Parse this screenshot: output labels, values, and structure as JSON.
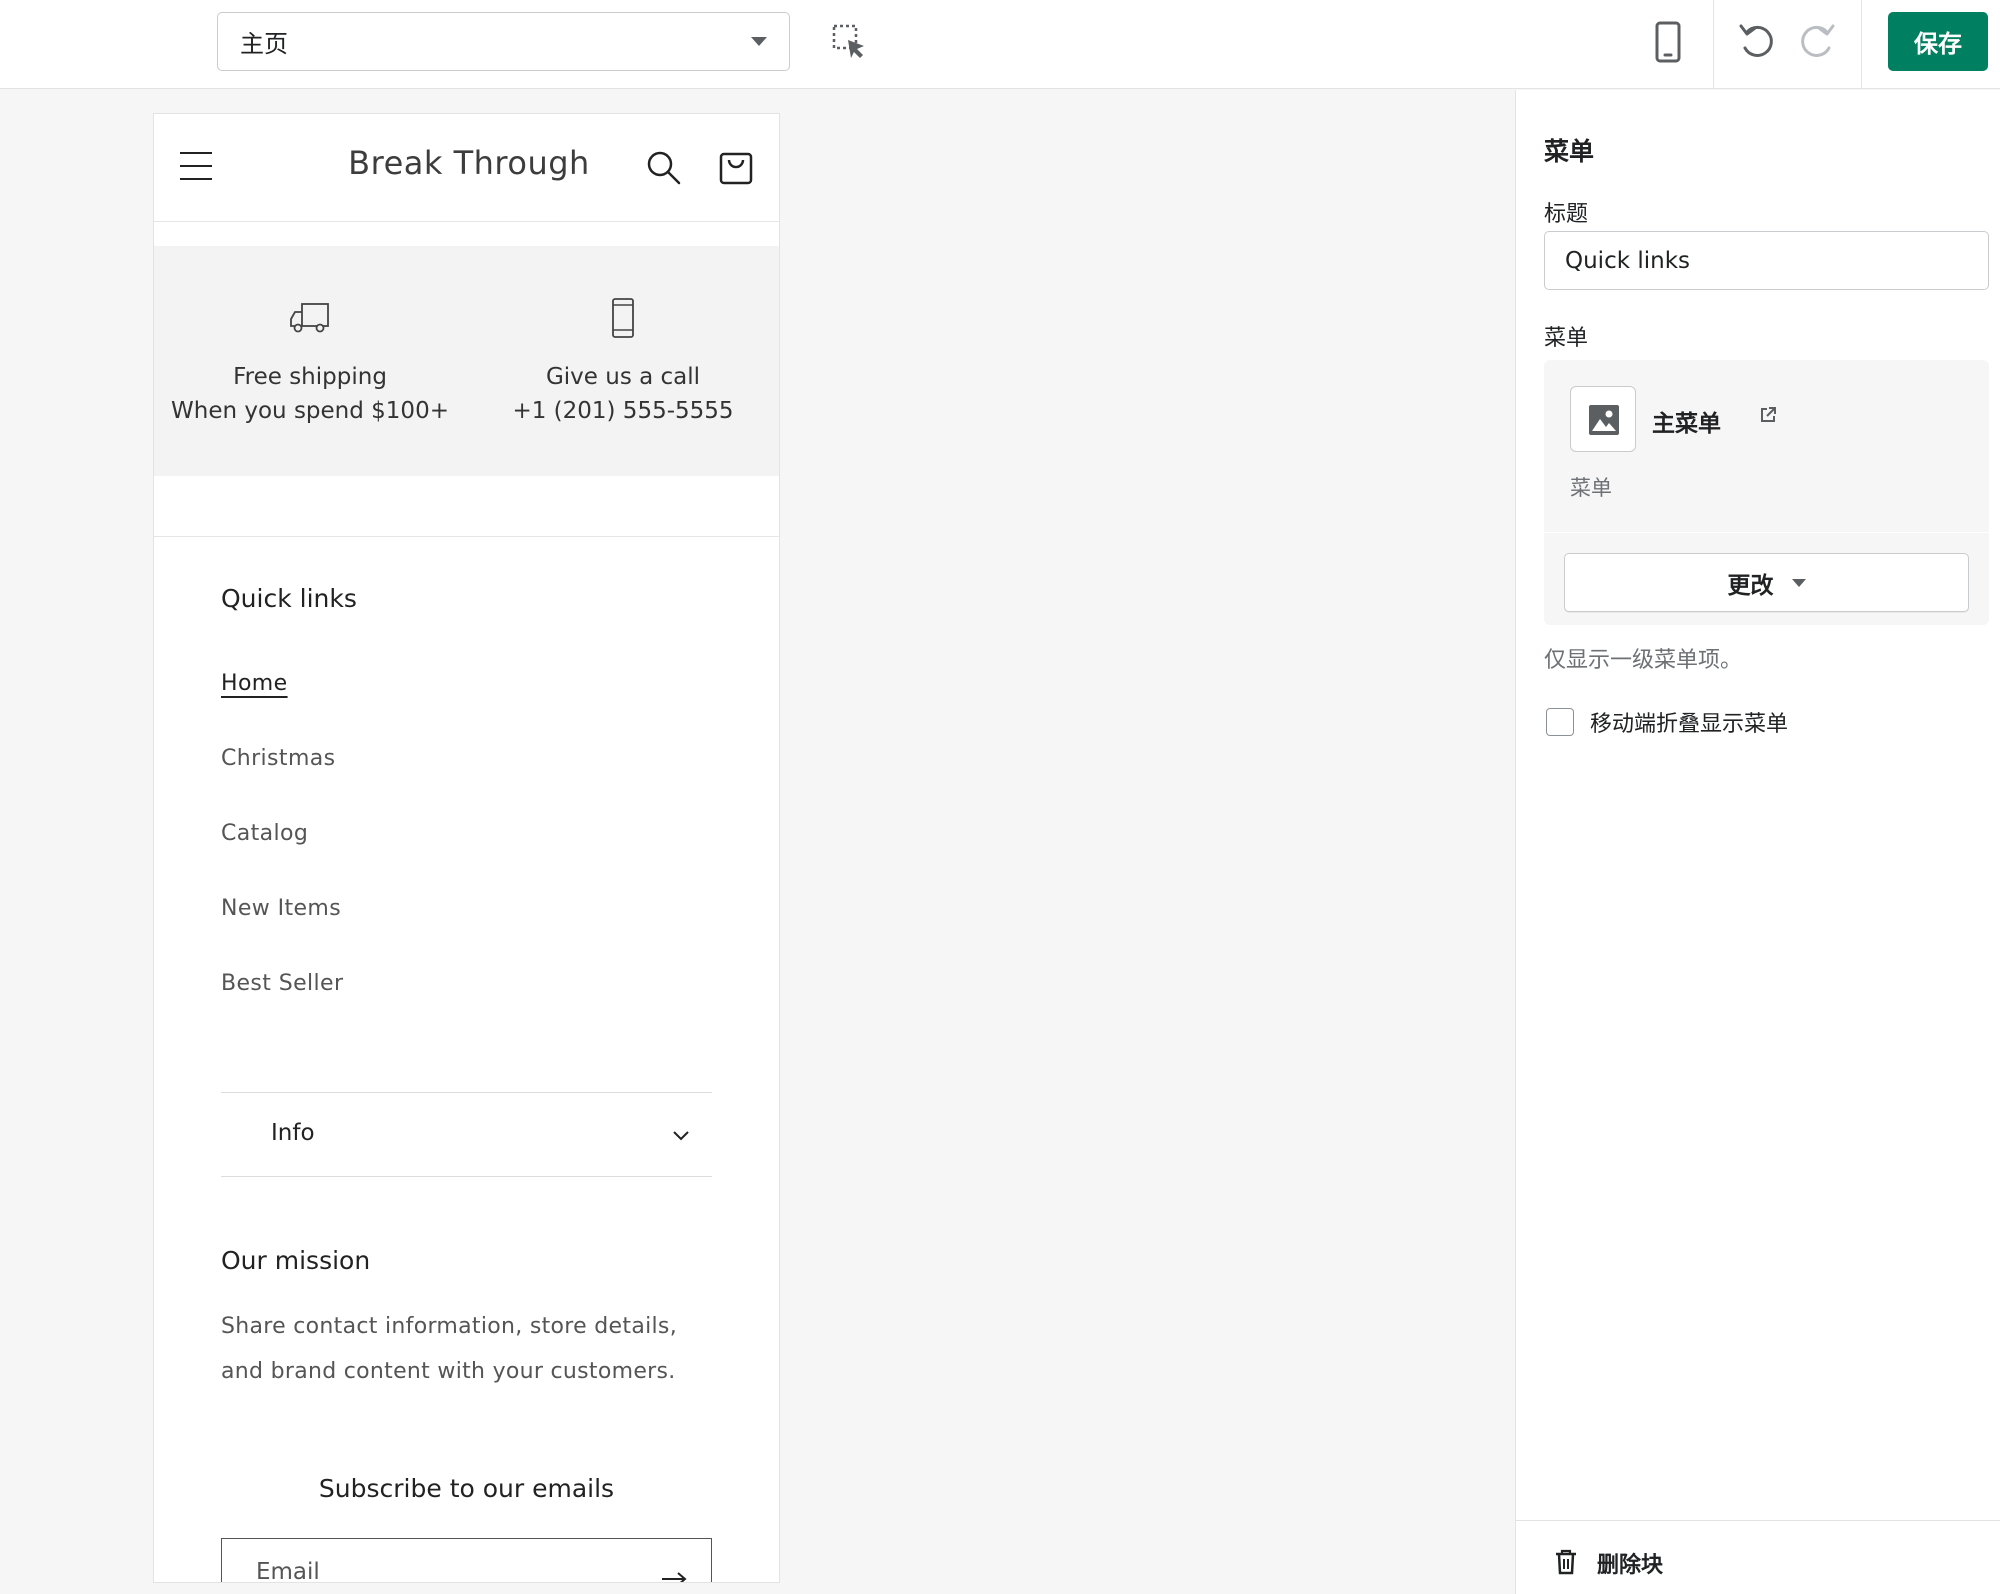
{
  "toolbar": {
    "page_select": "主页",
    "save_label": "保存"
  },
  "store": {
    "title": "Break Through",
    "promos": [
      {
        "line1": "Free shipping",
        "line2": "When you spend $100+"
      },
      {
        "line1": "Give us a call",
        "line2": "+1 (201) 555-5555"
      }
    ],
    "quick_links": {
      "title": "Quick links",
      "items": [
        "Home",
        "Christmas",
        "Catalog",
        "New Items",
        "Best Seller"
      ]
    },
    "info_label": "Info",
    "mission": {
      "title": "Our mission",
      "text": "Share contact information, store details, and brand content with your customers."
    },
    "subscribe": {
      "title": "Subscribe to our emails",
      "email_label": "Email"
    }
  },
  "panel": {
    "title": "菜单",
    "title_field_label": "标题",
    "title_field_value": "Quick links",
    "menu_label": "菜单",
    "menu_card": {
      "name": "主菜单",
      "subtitle": "菜单"
    },
    "change_label": "更改",
    "help_text": "仅显示一级菜单项。",
    "checkbox_label": "移动端折叠显示菜单",
    "delete_label": "删除块"
  },
  "colors": {
    "accent": "#008060",
    "panel_bg": "#ffffff",
    "canvas_bg": "#f6f6f7"
  }
}
